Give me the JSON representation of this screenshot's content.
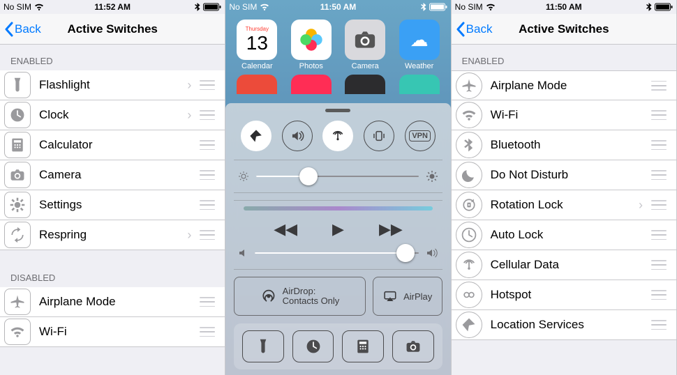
{
  "left": {
    "status": {
      "carrier": "No SIM",
      "time": "11:52 AM"
    },
    "nav": {
      "back": "Back",
      "title": "Active Switches"
    },
    "sections": [
      {
        "header": "ENABLED",
        "rows": [
          {
            "icon": "flashlight-icon",
            "label": "Flashlight",
            "chevron": true
          },
          {
            "icon": "clock-icon",
            "label": "Clock",
            "chevron": true
          },
          {
            "icon": "calculator-icon",
            "label": "Calculator",
            "chevron": false
          },
          {
            "icon": "camera-icon",
            "label": "Camera",
            "chevron": false
          },
          {
            "icon": "settings-icon",
            "label": "Settings",
            "chevron": false
          },
          {
            "icon": "respring-icon",
            "label": "Respring",
            "chevron": true
          }
        ]
      },
      {
        "header": "DISABLED",
        "rows": [
          {
            "icon": "airplane-icon",
            "label": "Airplane Mode",
            "chevron": false
          },
          {
            "icon": "wifi-icon",
            "label": "Wi-Fi",
            "chevron": false
          }
        ]
      }
    ]
  },
  "center": {
    "status": {
      "carrier": "No SIM",
      "time": "11:50 AM"
    },
    "apps": [
      {
        "name": "Calendar",
        "day": "Thursday",
        "date": "13",
        "color": "#ffffff"
      },
      {
        "name": "Photos",
        "color": "#ffffff"
      },
      {
        "name": "Camera",
        "color": "#d9d9dd"
      },
      {
        "name": "Weather",
        "color": "#3aa0f5"
      }
    ],
    "apps2_colors": [
      "#ec4b3a",
      "#ff2d55",
      "#2c2c2e",
      "#37c6b3"
    ],
    "toggles": [
      {
        "name": "location-icon",
        "active": true
      },
      {
        "name": "speaker-icon",
        "active": false
      },
      {
        "name": "cellular-icon",
        "active": true
      },
      {
        "name": "vibrate-icon",
        "active": false
      },
      {
        "name": "vpn-icon",
        "label": "VPN",
        "active": false
      }
    ],
    "brightness_pct": 32,
    "volume_pct": 92,
    "airdrop": {
      "title": "AirDrop:",
      "subtitle": "Contacts Only"
    },
    "airplay": "AirPlay",
    "quick": [
      "flashlight-icon",
      "clock-icon",
      "calculator-icon",
      "camera-icon"
    ]
  },
  "right": {
    "status": {
      "carrier": "No SIM",
      "time": "11:50 AM"
    },
    "nav": {
      "back": "Back",
      "title": "Active Switches"
    },
    "header": "ENABLED",
    "rows": [
      {
        "icon": "airplane-icon",
        "label": "Airplane Mode",
        "chevron": false
      },
      {
        "icon": "wifi-icon",
        "label": "Wi-Fi",
        "chevron": false
      },
      {
        "icon": "bluetooth-icon",
        "label": "Bluetooth",
        "chevron": false
      },
      {
        "icon": "dnd-icon",
        "label": "Do Not Disturb",
        "chevron": false
      },
      {
        "icon": "rotation-lock-icon",
        "label": "Rotation Lock",
        "chevron": true
      },
      {
        "icon": "auto-lock-icon",
        "label": "Auto Lock",
        "chevron": false
      },
      {
        "icon": "cellular-icon",
        "label": "Cellular Data",
        "chevron": false
      },
      {
        "icon": "hotspot-icon",
        "label": "Hotspot",
        "chevron": false
      },
      {
        "icon": "location-icon",
        "label": "Location Services",
        "chevron": false
      }
    ]
  }
}
